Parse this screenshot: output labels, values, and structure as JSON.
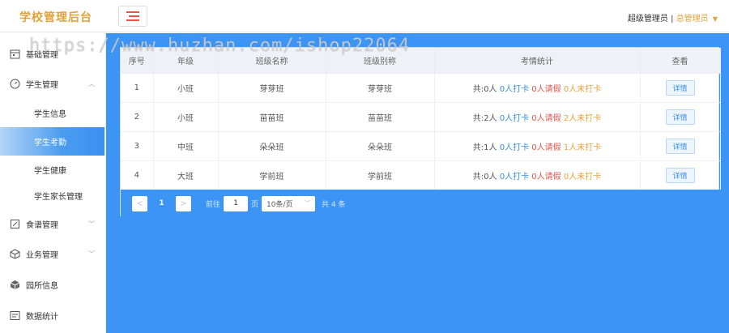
{
  "header": {
    "logo": "学校管理后台",
    "user_name": "超级管理员",
    "separator": "|",
    "role": "总管理员",
    "role_caret": "▼"
  },
  "sidebar": {
    "items": [
      {
        "label": "基础管理",
        "icon": "calendar-icon"
      },
      {
        "label": "学生管理",
        "icon": "gauge-icon",
        "arrow": "︿"
      },
      {
        "label": "学生信息"
      },
      {
        "label": "学生考勤"
      },
      {
        "label": "学生健康"
      },
      {
        "label": "学生家长管理"
      },
      {
        "label": "食谱管理",
        "icon": "edit-icon",
        "arrow": "﹀"
      },
      {
        "label": "业务管理",
        "icon": "box-icon",
        "arrow": "﹀"
      },
      {
        "label": "园所信息",
        "icon": "cube-icon"
      },
      {
        "label": "数据统计",
        "icon": "stats-icon"
      }
    ]
  },
  "table": {
    "headers": [
      "序号",
      "年级",
      "班级名称",
      "班级别称",
      "考情统计",
      "查看"
    ],
    "rows": [
      {
        "no": "1",
        "grade": "小班",
        "name": "芽芽班",
        "alias": "芽芽班",
        "total": "共:0人",
        "checkin": "0人打卡",
        "leave": "0人请假",
        "miss": "0人未打卡",
        "action": "详情"
      },
      {
        "no": "2",
        "grade": "小班",
        "name": "苗苗班",
        "alias": "苗苗班",
        "total": "共:2人",
        "checkin": "0人打卡",
        "leave": "0人请假",
        "miss": "2人未打卡",
        "action": "详情"
      },
      {
        "no": "3",
        "grade": "中班",
        "name": "朵朵班",
        "alias": "朵朵班",
        "total": "共:1人",
        "checkin": "0人打卡",
        "leave": "0人请假",
        "miss": "1人未打卡",
        "action": "详情"
      },
      {
        "no": "4",
        "grade": "大班",
        "name": "学前班",
        "alias": "学前班",
        "total": "共:0人",
        "checkin": "0人打卡",
        "leave": "0人请假",
        "miss": "0人未打卡",
        "action": "详情"
      }
    ]
  },
  "pager": {
    "prev": "<",
    "current": "1",
    "next": ">",
    "goto_label": "前往",
    "goto_value": "1",
    "page_unit": "页",
    "page_size": "10条/页",
    "total": "共 4 条"
  },
  "watermark": "https://www.huzhan.com/ishop22064"
}
